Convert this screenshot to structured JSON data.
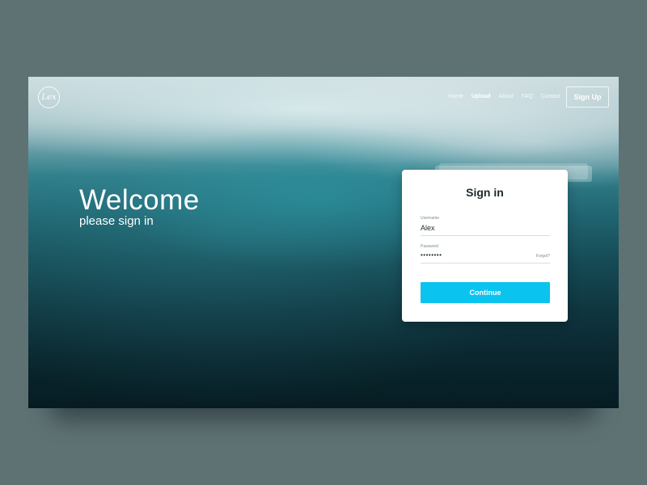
{
  "header": {
    "logo_text": "Lex",
    "nav": [
      {
        "label": "Home",
        "active": false
      },
      {
        "label": "Upload",
        "active": true
      },
      {
        "label": "About",
        "active": false
      },
      {
        "label": "FAQ",
        "active": false
      },
      {
        "label": "Contact",
        "active": false
      }
    ],
    "signup_label": "Sign Up"
  },
  "hero": {
    "title": "Welcome",
    "subtitle": "please sign in"
  },
  "signin": {
    "title": "Sign in",
    "username_label": "Username",
    "username_value": "Alex",
    "password_label": "Password",
    "password_value": "••••••••",
    "forgot_label": "Forgot?",
    "continue_label": "Continue"
  },
  "colors": {
    "accent": "#0bc3ef",
    "page_background": "#5f7273"
  }
}
